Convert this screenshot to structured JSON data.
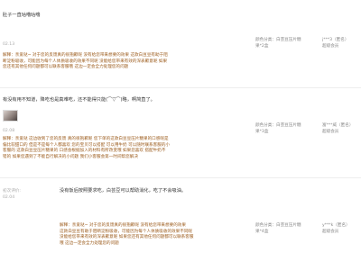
{
  "reviews": [
    {
      "text": "肚子一直咕噜咕噜",
      "date": "02.13",
      "reply": [
        "解释：亲爱哒~ 对于您的反馈真的很抱歉呢 没有给您带来想要的效果 这款白豆豆有助于阻",
        "断淀粉吸收，可能因为每个人体质吸收的效果不同呢 没能给您带来有效的深表歉意呢 如果",
        "您还有其他任何问题都可以联系客服哦 这边一定会全力处理您的问题"
      ],
      "meta": [
        "颜色分类：白芸豆压片糖",
        "果*2盒"
      ],
      "user": [
        "j***3（匿名）",
        "超级会员"
      ]
    },
    {
      "text": "有没有用不知道，降吃也是真难吃，还不能得只能(⌒▽⌒)略，啊简直了。",
      "date": "02.08",
      "reply": [
        "解释：亲爱哒 这边收到了您的反馈 真的很抱歉呢 您下单的这款白豆豆压片糖果的口感呢是",
        "偏比较甜口的 但是不是每个人都喜欢 您的宝贝可以搭配 可以用牛奶 可以随时联系客服的小",
        "客服的 这款白豆豆压片糖果的 口感会根据加入的材料有所改变哦 如果您喜欢 搭配牛奶不",
        "错的 如果您遇到了不能自行解决的小问题 我们小客服会第一时间帮您解决"
      ],
      "meta": [
        "颜色分类：白芸豆压片糖",
        "果*3盒"
      ],
      "user": [
        "富***威（匿名）",
        "超级会员"
      ]
    },
    {
      "followup_label": "初次评价:",
      "followup_date": "02.04",
      "text": "没有饭后按照要求吃，白芸豆可以帮助消化，吃了不会吸油。",
      "reply": [
        "解释：亲爱哒~ 对于您的反馈真的很抱歉呢 没有给您带来想要的效果",
        "这款白豆豆有助于阻断淀粉吸收，可能因为每个人体质吸收的效果不同呢",
        "没能给您带来有效的深表歉意呢 如果您还有其他任何问题都可以联系客服",
        "哦 这边一定会全力处理您的问题"
      ],
      "meta": [
        "颜色分类：白芸豆压片糖",
        "果*4盒"
      ],
      "user": [
        "y***k（匿名）",
        "超级会员"
      ]
    }
  ]
}
